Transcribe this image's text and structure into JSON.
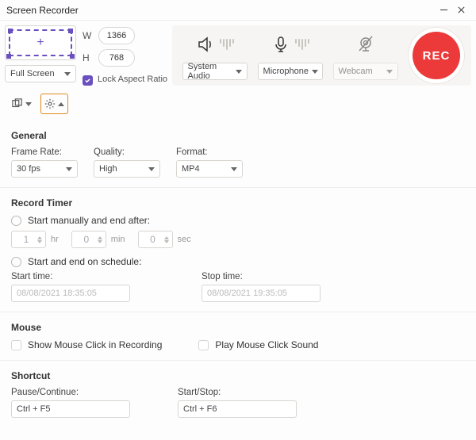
{
  "window": {
    "title": "Screen Recorder"
  },
  "region": {
    "mode": "Full Screen",
    "width": "1366",
    "height": "768",
    "lock_label": "Lock Aspect Ratio",
    "w_label": "W",
    "h_label": "H"
  },
  "sources": {
    "audio": {
      "label": "System Audio"
    },
    "mic": {
      "label": "Microphone"
    },
    "webcam": {
      "label": "Webcam"
    }
  },
  "rec_label": "REC",
  "general": {
    "title": "General",
    "frame_label": "Frame Rate:",
    "frame_value": "30 fps",
    "quality_label": "Quality:",
    "quality_value": "High",
    "format_label": "Format:",
    "format_value": "MP4"
  },
  "timer": {
    "title": "Record Timer",
    "manual_label": "Start manually and end after:",
    "hr": "1",
    "hr_unit": "hr",
    "min": "0",
    "min_unit": "min",
    "sec": "0",
    "sec_unit": "sec",
    "schedule_label": "Start and end on schedule:",
    "start_label": "Start time:",
    "stop_label": "Stop time:",
    "start_value": "08/08/2021 18:35:05",
    "stop_value": "08/08/2021 19:35:05"
  },
  "mouse": {
    "title": "Mouse",
    "show_label": "Show Mouse Click in Recording",
    "sound_label": "Play Mouse Click Sound"
  },
  "shortcut": {
    "title": "Shortcut",
    "pause_label": "Pause/Continue:",
    "pause_value": "Ctrl + F5",
    "startstop_label": "Start/Stop:",
    "startstop_value": "Ctrl + F6"
  }
}
